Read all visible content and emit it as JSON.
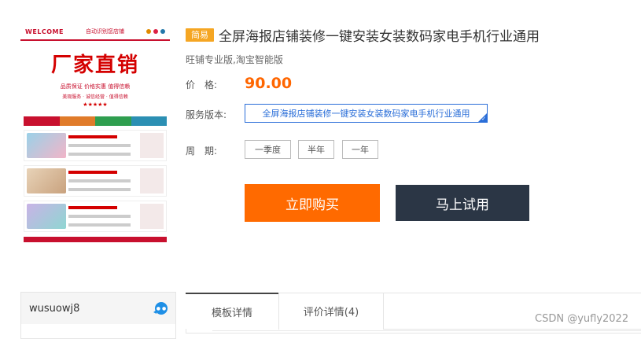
{
  "thumbnail": {
    "welcome": "WELCOME",
    "welcome_sub": "自动识别您店铺",
    "hero_title": "厂家直销",
    "hero_tags": "品质保证  价格实惠  值得信赖",
    "hero_line": "美观服务 · 诚信经营 · 值得信赖",
    "hero_stars": "★★★★★",
    "colors": [
      "#c8102e",
      "#e07b2a",
      "#2f9e4f",
      "#2b8fb3"
    ]
  },
  "product": {
    "badge": "简易",
    "title": "全屏海报店铺装修一键安装女装数码家电手机行业通用",
    "subtitle": "旺铺专业版,淘宝智能版",
    "price_label": "价　格:",
    "price": "90.00",
    "version_label": "服务版本:",
    "version_option": "全屏海报店铺装修一键安装女装数码家电手机行业通用",
    "period_label": "周　期:",
    "period_options": [
      "一季度",
      "半年",
      "一年"
    ]
  },
  "actions": {
    "buy_label": "立即购买",
    "try_label": "马上试用"
  },
  "shop": {
    "name": "wusuowj8"
  },
  "tabs": {
    "items": [
      "模板详情",
      "评价详情(4)"
    ]
  },
  "watermark": "CSDN @yufly2022"
}
